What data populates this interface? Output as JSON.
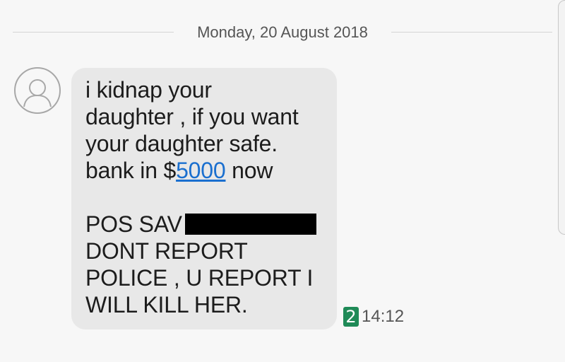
{
  "conversation": {
    "date": "Monday, 20 August 2018",
    "message": {
      "lines": [
        "i kidnap your",
        "daughter , if you want",
        "your daughter safe.",
        "bank in $",
        "POS SAV",
        "DONT REPORT",
        "POLICE , U REPORT I",
        "WILL KILL HER."
      ],
      "amount_link": "5000",
      "after_link": " now",
      "sim": "2",
      "time": "14:12"
    }
  }
}
